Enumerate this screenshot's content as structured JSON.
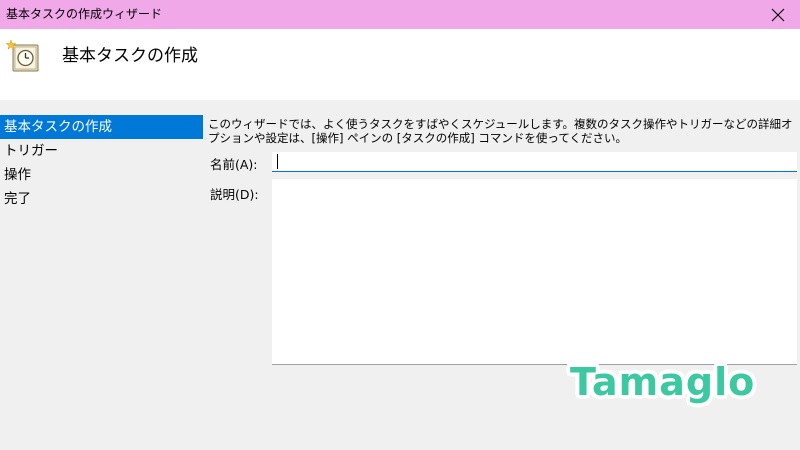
{
  "window": {
    "title": "基本タスクの作成ウィザード",
    "title_bar_color": "#f0a8e8",
    "close_icon": "close-icon"
  },
  "header": {
    "heading": "基本タスクの作成",
    "icon": "task-scheduler-clock-icon"
  },
  "sidebar": {
    "accent_color": "#0078d7",
    "steps": [
      {
        "label": "基本タスクの作成",
        "active": true
      },
      {
        "label": "トリガー",
        "active": false
      },
      {
        "label": "操作",
        "active": false
      },
      {
        "label": "完了",
        "active": false
      }
    ]
  },
  "main": {
    "description": "このウィザードでは、よく使うタスクをすばやくスケジュールします。複数のタスク操作やトリガーなどの詳細オプションや設定は、[操作] ペインの [タスクの作成] コマンドを使ってください。",
    "name_label": "名前(A):",
    "name_value": "",
    "description_label": "説明(D):",
    "description_value": ""
  },
  "watermark": {
    "text": "Tamaglo",
    "color": "#3cc8a0"
  }
}
